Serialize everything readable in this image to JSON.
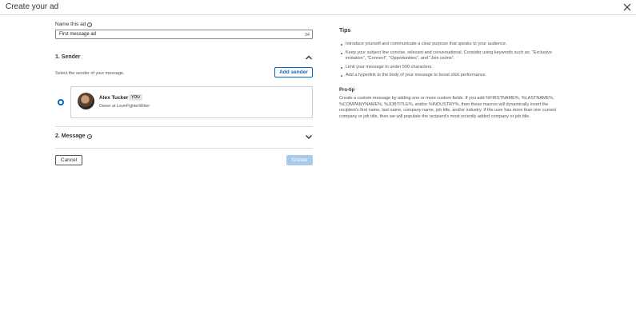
{
  "header": {
    "title": "Create your ad",
    "close_icon": "close-icon"
  },
  "form": {
    "name_label": "Name this ad",
    "name_value": "First message ad",
    "name_char_count": "34",
    "sender_section": {
      "title": "1.  Sender",
      "subtext": "Select the sender of your message.",
      "add_sender_label": "Add sender",
      "sender": {
        "name": "Alex Tucker",
        "badge": "YOU",
        "subtitle": "Owner at LoverFighterWriter",
        "selected": true
      }
    },
    "message_section": {
      "title": "2.  Message"
    },
    "cancel_label": "Cancel",
    "create_label": "Create"
  },
  "tips": {
    "title": "Tips",
    "items": [
      "Introduce yourself and communicate a clear purpose that speaks to your audience.",
      "Keep your subject line concise, relevant and conversational. Consider using keywords such as: \"Exclusive invitation\", \"Connect\", \"Opportunities\", and \"Join us/me\".",
      "Limit your message to under 500 characters.",
      "Add a hyperlink to the body of your message to boost click performance."
    ],
    "protip_title": "Pro-tip",
    "protip_text": "Create a custom message by adding one or more custom fields. If you add %FIRSTNAME%, %LASTNAME%, %COMPANYNAME%, %JOBTITLE%, and/or %INDUSTRY%, then these macros will dynamically insert the recipient's first name, last name, company name, job title, and/or industry. If the user has more than one current company or job title, then we will populate the recipient's most recently added company or job title."
  },
  "colors": {
    "accent": "#0a66c2",
    "disabled_button": "#a9cbea"
  }
}
